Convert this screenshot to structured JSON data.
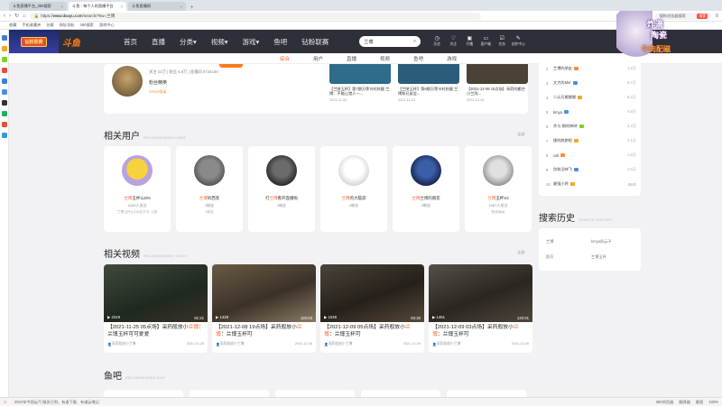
{
  "browser": {
    "tabs": [
      {
        "label": "斗鱼直播平台_360搜索",
        "active": false
      },
      {
        "label": "斗鱼 - 每个人的直播平台",
        "active": true
      },
      {
        "label": "斗鱼直播网",
        "active": false
      }
    ],
    "url_prefix": "https://",
    "url_domain": "www.douyu.com",
    "url_path": "/search/?kw=兰博",
    "search_placeholder": "搜狗浏览器搜索",
    "search_button": "搜索",
    "bookmarks": [
      "收藏",
      "手机收藏夹",
      "谷歌",
      "网址导航",
      "360搜索",
      "游戏中心"
    ]
  },
  "header": {
    "banner_text": "钻粉联赛",
    "logo": "斗鱼",
    "nav": [
      "首页",
      "直播",
      "分类▾",
      "视频▾",
      "游戏▾",
      "鱼吧",
      "钻粉联赛"
    ],
    "search_value": "兰博",
    "icons": [
      {
        "name": "history-icon",
        "label": "历史"
      },
      {
        "name": "follow-icon",
        "label": "关注"
      },
      {
        "name": "live-icon",
        "label": "开播"
      },
      {
        "name": "client-icon",
        "label": "客户端"
      },
      {
        "name": "task-icon",
        "label": "任务"
      },
      {
        "name": "creator-icon",
        "label": "创作中心"
      }
    ]
  },
  "subtabs": [
    {
      "label": "综合",
      "active": true
    },
    {
      "label": "用户",
      "active": false
    },
    {
      "label": "直播",
      "active": false
    },
    {
      "label": "视频",
      "active": false
    },
    {
      "label": "鱼吧",
      "active": false
    },
    {
      "label": "游戏",
      "active": false
    }
  ],
  "top_card": {
    "meta": "关注 23万  |  粉丝 6.8万  |  直播间 8726180",
    "username": "粉丝精英",
    "level": "AAAA领英",
    "mini_videos": [
      {
        "title": "【兰陵玉杯】第7期万等节村秋腿 兰博：不能让猎人一...",
        "date": "2021-11-03"
      },
      {
        "title": "【兰陵玉杯】第6期万等节村秋腿 兰博和兄弟会...",
        "date": "2021-11-03"
      },
      {
        "title": "【2021-12-06 15点场】采药的搬空小兰雨...",
        "date": "2021-12-06"
      }
    ]
  },
  "related_users": {
    "title": "相关用户",
    "subtitle": "RECOMMENDED USER",
    "more": "全部",
    "users": [
      {
        "pre": "",
        "hl": "兰博",
        "post": "玉杯山ON",
        "stat": "4160人关注",
        "desc": "兰博玉杯山ON官方号 斗鱼"
      },
      {
        "pre": "",
        "hl": "兰博",
        "post": "的西装",
        "stat": "1粉丝",
        "desc": "1粉丝"
      },
      {
        "pre": "打",
        "hl": "兰博",
        "post": "看开直播啦",
        "stat": "1粉丝",
        "desc": ""
      },
      {
        "pre": "",
        "hl": "兰博",
        "post": "的大脑袋",
        "stat": "1粉丝",
        "desc": ""
      },
      {
        "pre": "",
        "hl": "兰博",
        "post": "兰博的朋友",
        "stat": "3粉丝",
        "desc": ""
      },
      {
        "pre": "",
        "hl": "兰博",
        "post": "玉杯S4",
        "stat": "1087人关注",
        "desc": "粉丝精英"
      }
    ]
  },
  "related_videos": {
    "title": "相关视频",
    "subtitle": "RECOMMENDED VIDEO",
    "more": "全部",
    "videos": [
      {
        "plays": "2319",
        "duration": "91:21",
        "pre": "【2021-11-25 05点场】采药般放小",
        "hl": "兰博",
        "post": "：兰博玉杯可可爱爱",
        "author": "采药般放小兰博",
        "date": "2021-11-25"
      },
      {
        "plays": "1429",
        "duration": "120:03",
        "pre": "【2021-12-08 19点场】采药般放小",
        "hl": "兰博",
        "post": "：兰博玉杯可",
        "author": "采药般放小兰博",
        "date": "2021-12-08"
      },
      {
        "plays": "1049",
        "duration": "83:30",
        "pre": "【2021-12-09 05点场】采药般放小",
        "hl": "兰博",
        "post": "：兰博玉杯可",
        "author": "采药般放小兰博",
        "date": "2021-12-09"
      },
      {
        "plays": "1461",
        "duration": "120:01",
        "pre": "【2021-12-09 03点场】采药般放小",
        "hl": "兰博",
        "post": "：兰博玉杯可",
        "author": "采药般放小兰博",
        "date": "2021-12-09"
      }
    ]
  },
  "fish_bar": {
    "title": "鱼吧",
    "subtitle": "RECOMMENDED BAR"
  },
  "ranking": [
    {
      "n": "2",
      "name": "兰博的朋友",
      "tag": "#ff8a3d",
      "count": "1.2万"
    },
    {
      "n": "3",
      "name": "文大的Mer",
      "tag": "#4a90e2",
      "count": "8.7万"
    },
    {
      "n": "4",
      "name": "二元兄搬搬搬",
      "tag": "#f5a623",
      "count": "6.2万"
    },
    {
      "n": "5",
      "name": "kmya",
      "tag": "#4a90e2",
      "count": "4.8万"
    },
    {
      "n": "6",
      "name": "余与·朗的映映",
      "tag": "#7ed321",
      "count": "3.2万"
    },
    {
      "n": "7",
      "name": "捷的跑跑呢",
      "tag": "#f5a623",
      "count": "2.1万"
    },
    {
      "n": "8",
      "name": "cell",
      "tag": "#ff8a3d",
      "count": "1.5万"
    },
    {
      "n": "9",
      "name": "剑和羽神飞",
      "tag": "#4a90e2",
      "count": "1.0万"
    },
    {
      "n": "10",
      "name": "最强小将",
      "tag": "#f5a623",
      "count": "8560"
    }
  ],
  "search_history": {
    "title": "搜索历史",
    "subtitle": "SEARCH HISTORY",
    "items": [
      "兰博",
      "kmya机云子",
      "凯芬",
      "兰博玉杯"
    ]
  },
  "overlay": {
    "line1": "炸滴",
    "line2": "陶瓷",
    "line3": "牛肉配磁"
  },
  "statusbar": {
    "left": "2022年中国云汽 服务已到，有道下载、有道云笔记",
    "right": [
      "360浏览器",
      "翻译器",
      "截图",
      "100%"
    ]
  }
}
